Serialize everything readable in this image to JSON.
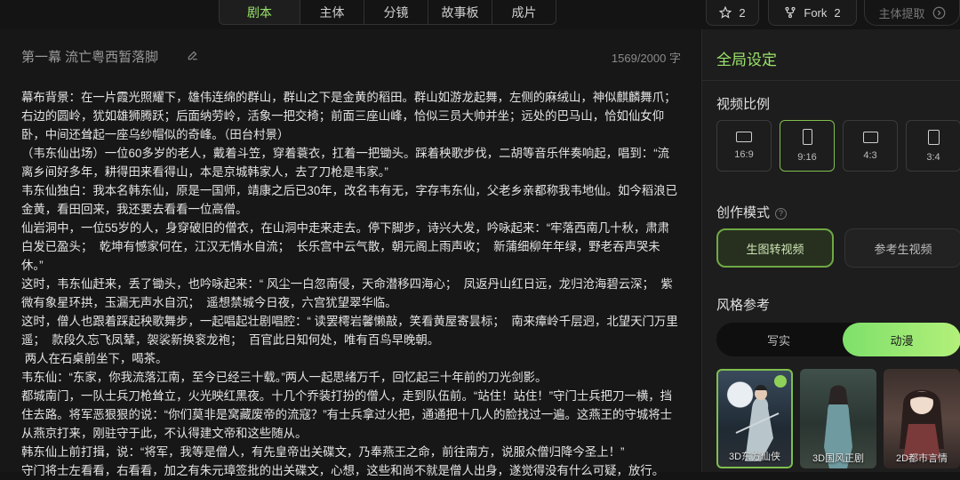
{
  "tabs": [
    {
      "label": "剧本",
      "active": true
    },
    {
      "label": "主体"
    },
    {
      "label": "分镜"
    },
    {
      "label": "故事板"
    },
    {
      "label": "成片"
    }
  ],
  "top_actions": {
    "star": {
      "count": "2"
    },
    "fork": {
      "label": "Fork",
      "count": "2"
    },
    "extract": {
      "label": "主体提取"
    }
  },
  "editor": {
    "title": "第一幕 流亡粤西暂落脚",
    "char_count": "1569/2000 字",
    "paragraphs": [
      "幕布背景：在一片霞光照耀下，雄伟连绵的群山，群山之下是金黄的稻田。群山如游龙起舞，左侧的麻绒山，神似麒麟舞爪；右边的圆岭，犹如雄狮腾跃；后面纳劳岭，活象一把交椅；前面三座山峰，恰似三员大帅并坐；远处的巴马山，恰如仙女仰卧，中间还耸起一座乌纱帽似的奇峰。（田台村景）",
      "（韦东仙出场）一位60多岁的老人，戴着斗笠，穿着蓑衣，扛着一把锄头。踩着秧歌步伐，二胡等音乐伴奏响起，唱到：“流离乡间好多年，耕得田来看得山，本是京城韩家人，去了刀枪是韦家。”",
      "韦东仙独白：我本名韩东仙，原是一国师，靖康之后已30年，改名韦有无，字存韦东仙，父老乡亲都称我韦地仙。如今稻浪已金黄，看田回来，我还要去看看一位高僧。",
      "仙岩洞中，一位55岁的人，身穿破旧的僧衣，在山洞中走来走去。停下脚步，诗兴大发，吟咏起来：“牢落西南几十秋，肃肃白发已盈头；  乾坤有憾家何在，江汉无情水自流；  长乐宫中云气散，朝元阁上雨声收；  新蒲细柳年年绿，野老吞声哭未休。”",
      "这时，韦东仙赶来，丢了锄头，也吟咏起来：“ 风尘一白忽南侵，天命潜移四海心；  凤返丹山红日远，龙归沧海碧云深；  紫微有象星环拱，玉漏无声水自沉；  遥想禁城今日夜，六宫犹望翠华临。",
      "这时，僧人也跟着踩起秧歌舞步，一起唱起壮剧唱腔：“ 读罢樗岩馨懒敲，笑看黄屋寄昙标；  南来瘴岭千层迥，北望天门万里遥；  款段久忘飞凤辇，袈裟新换衮龙袍；  百官此日知何处，唯有百鸟早晚朝。",
      " 两人在石桌前坐下，喝茶。",
      "韦东仙：“东家，你我流落江南，至今已经三十载。”两人一起思绪万千，回忆起三十年前的刀光剑影。",
      "都城南门，一队士兵刀枪耸立，火光映红黑夜。十几个乔装打扮的僧人，走到队伍前。“站住！站住！”守门士兵把刀一横，挡住去路。将军恶狠狠的说：“你们莫非是窝藏废帝的流寇？”有士兵拿过火把，通通把十几人的脸找过一遍。这燕王的守城将士从燕京打来，刚驻守于此，不认得建文帝和这些随从。",
      "韩东仙上前打揖，说：“将军，我等是僧人，有先皇帝出关碟文，乃奉燕王之命，前往南方，说服众僧归降今圣上！”",
      "守门将士左看看，右看看，加之有朱元璋签批的出关碟文，心想，这些和尚不就是僧人出身，遂觉得没有什么可疑，放行。"
    ]
  },
  "panel": {
    "title": "全局设定",
    "ratio_title": "视频比例",
    "ratios": [
      {
        "label": "16:9"
      },
      {
        "label": "9:16",
        "active": true
      },
      {
        "label": "4:3"
      },
      {
        "label": "3:4"
      }
    ],
    "mode_title": "创作模式",
    "modes": [
      {
        "label": "生图转视频",
        "active": true
      },
      {
        "label": "参考生视频"
      }
    ],
    "style_title": "风格参考",
    "style_options": [
      {
        "label": "写实"
      },
      {
        "label": "动漫",
        "active": true
      }
    ],
    "thumbs": [
      {
        "label": "3D东方仙侠",
        "active": true
      },
      {
        "label": "3D国风正剧"
      },
      {
        "label": "2D都市言情"
      }
    ]
  },
  "colors": {
    "accent": "#9be36a",
    "background": "#141414",
    "panel": "#1d1d1d"
  }
}
